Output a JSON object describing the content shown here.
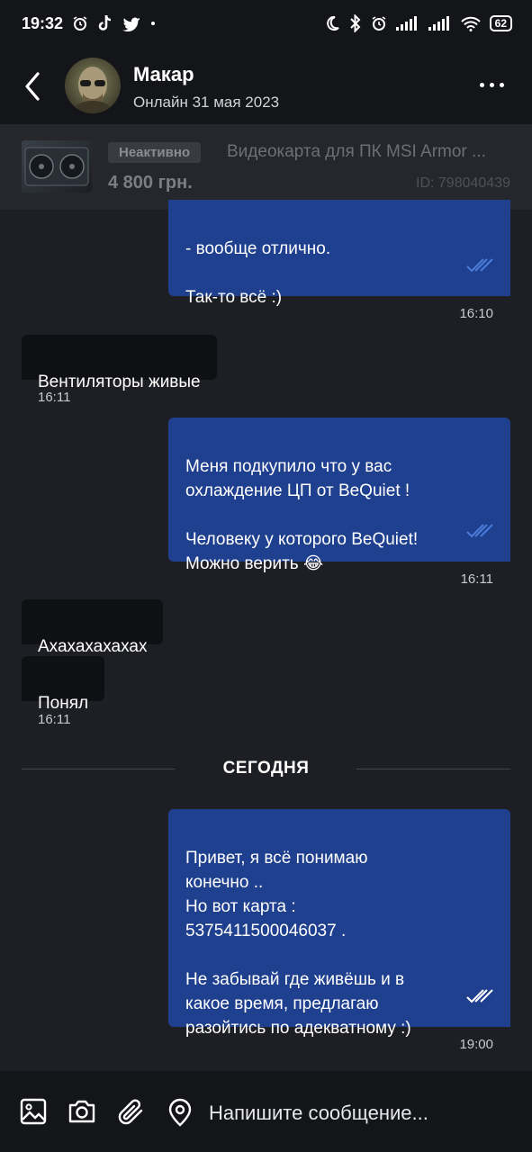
{
  "status": {
    "time": "19:32",
    "battery": "62"
  },
  "header": {
    "contact_name": "Макар",
    "online_status": "Онлайн 31 мая 2023"
  },
  "ad": {
    "badge": "Неактивно",
    "title": "Видеокарта для ПК MSI Armor ...",
    "price": "4 800 грн.",
    "id": "ID: 798040439"
  },
  "messages": {
    "m1": {
      "text": "- вообще отлично.\n\nТак-то всё :)",
      "time": "16:10"
    },
    "m2": {
      "text": "Вентиляторы живые",
      "time": "16:11"
    },
    "m3": {
      "text": "Меня подкупило что у вас\nохлаждение ЦП от BeQuiet !\n\nЧеловеку у которого BeQuiet!\nМожно верить 😂",
      "time": "16:11"
    },
    "m4": {
      "text": "Ахахахахахах"
    },
    "m5": {
      "text": "Понял",
      "time": "16:11"
    },
    "divider": "СЕГОДНЯ",
    "m6": {
      "text": "Привет, я всё понимаю\nконечно ..\nНо вот карта :\n5375411500046037 .\n\nНе забывай где живёшь и в\nкакое время, предлагаю\nразойтись по адекватному :)",
      "time": "19:00"
    }
  },
  "composer": {
    "placeholder": "Напишите сообщение...",
    "icons": [
      "image-icon",
      "camera-icon",
      "paperclip-icon",
      "location-icon"
    ]
  },
  "colors": {
    "outgoing_bubble": "#1f3f8f",
    "incoming_bubble": "#0f1014",
    "background": "#1e1f24",
    "read_ticks": "#4a7bd8"
  }
}
